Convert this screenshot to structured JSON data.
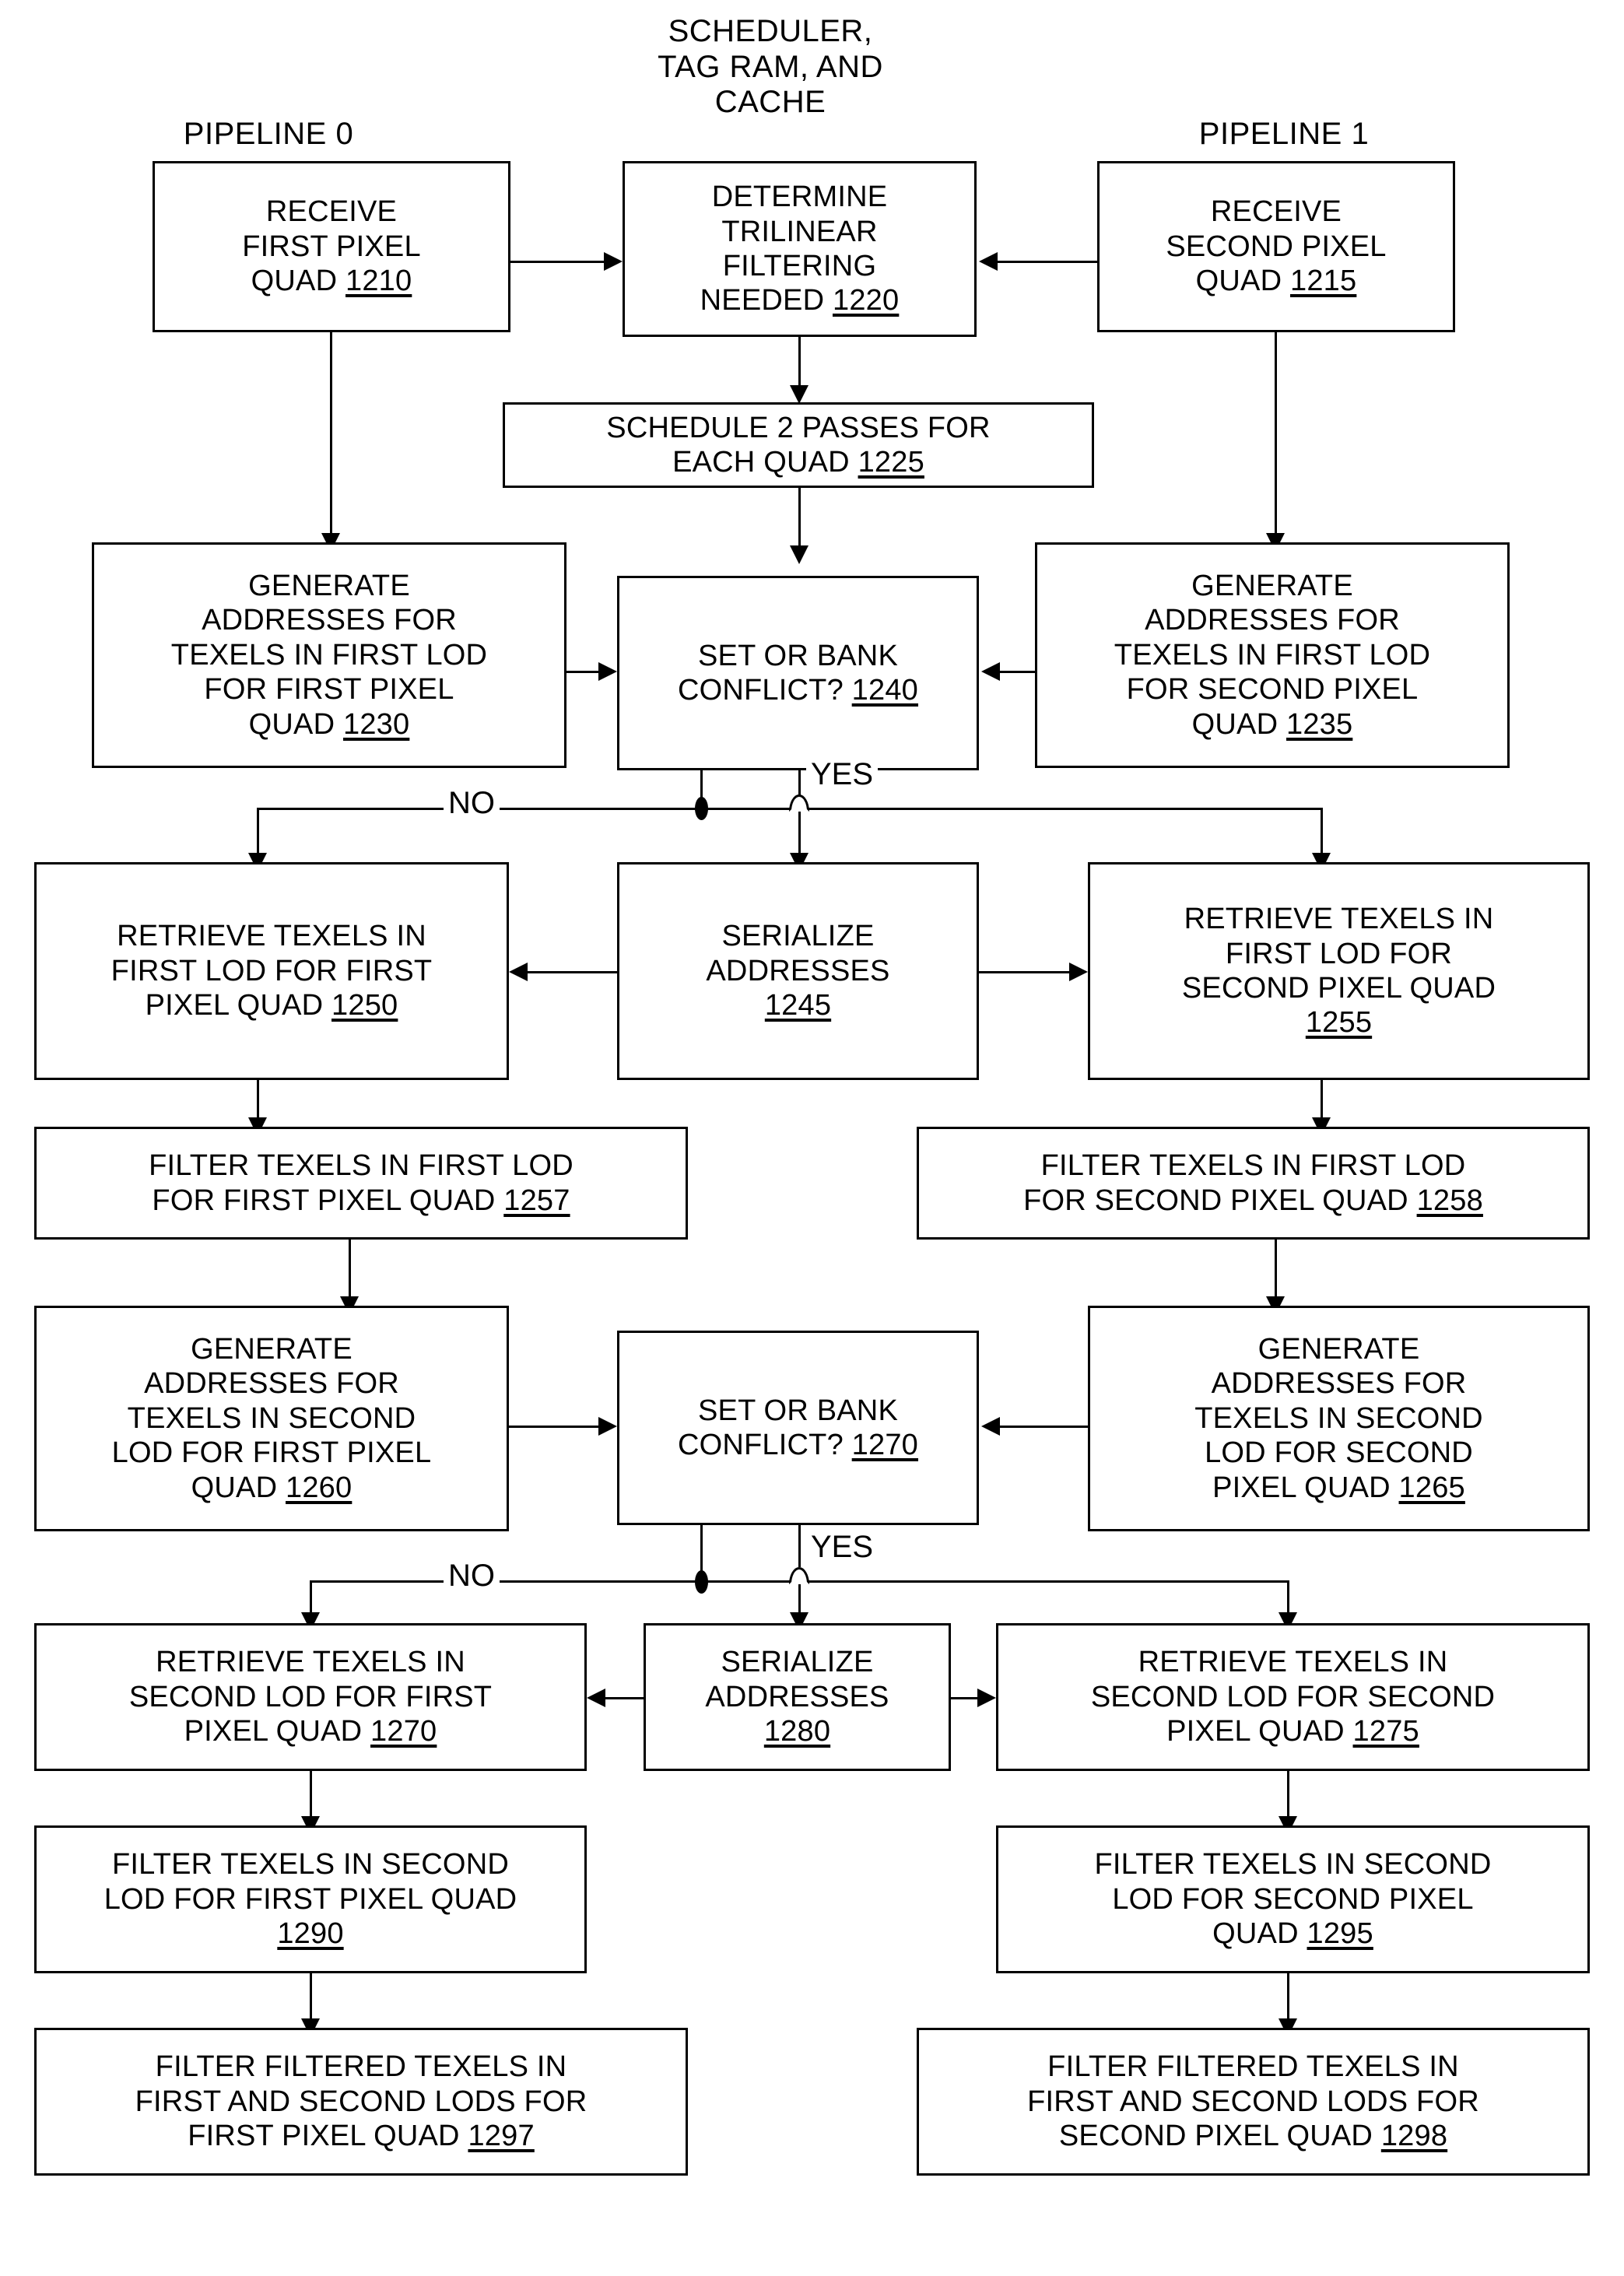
{
  "figure": {
    "type": "flowchart",
    "captions": [
      {
        "id": "pipeline0",
        "text": "PIPELINE 0"
      },
      {
        "id": "scheduler",
        "text": "SCHEDULER,\nTAG RAM, AND\nCACHE"
      },
      {
        "id": "pipeline1",
        "text": "PIPELINE 1"
      }
    ],
    "edge_labels": [
      {
        "id": "no1",
        "text": "NO"
      },
      {
        "id": "yes1",
        "text": "YES"
      },
      {
        "id": "no2",
        "text": "NO"
      },
      {
        "id": "yes2",
        "text": "YES"
      }
    ],
    "nodes": [
      {
        "id": "n1210",
        "lines": [
          "RECEIVE",
          "FIRST PIXEL",
          "QUAD "
        ],
        "ref": "1210"
      },
      {
        "id": "n1220",
        "lines": [
          "DETERMINE",
          "TRILINEAR",
          "FILTERING",
          "NEEDED  "
        ],
        "ref": "1220"
      },
      {
        "id": "n1215",
        "lines": [
          "RECEIVE",
          "SECOND PIXEL",
          "QUAD "
        ],
        "ref": "1215"
      },
      {
        "id": "n1225",
        "lines": [
          "SCHEDULE 2 PASSES FOR",
          "EACH QUAD  "
        ],
        "ref": "1225"
      },
      {
        "id": "n1230",
        "lines": [
          "GENERATE",
          "ADDRESSES  FOR",
          "TEXELS IN FIRST LOD",
          "FOR FIRST PIXEL",
          "QUAD "
        ],
        "ref": "1230"
      },
      {
        "id": "n1240",
        "lines": [
          "SET OR BANK",
          "CONFLICT?  "
        ],
        "ref": "1240"
      },
      {
        "id": "n1235",
        "lines": [
          "GENERATE",
          "ADDRESSES FOR",
          "TEXELS IN FIRST LOD",
          "FOR SECOND PIXEL",
          "QUAD  "
        ],
        "ref": "1235"
      },
      {
        "id": "n1250",
        "lines": [
          "RETRIEVE TEXELS IN",
          "FIRST LOD FOR FIRST",
          "PIXEL QUAD  "
        ],
        "ref": "1250"
      },
      {
        "id": "n1245",
        "lines": [
          "SERIALIZE",
          "ADDRESSES",
          ""
        ],
        "ref": "1245"
      },
      {
        "id": "n1255",
        "lines": [
          "RETRIEVE TEXELS IN",
          "FIRST LOD FOR",
          "SECOND PIXEL QUAD",
          ""
        ],
        "ref": "1255"
      },
      {
        "id": "n1257",
        "lines": [
          "FILTER TEXELS IN FIRST LOD",
          "FOR FIRST PIXEL QUAD  "
        ],
        "ref": "1257"
      },
      {
        "id": "n1258",
        "lines": [
          "FILTER TEXELS IN FIRST LOD",
          "FOR SECOND PIXEL QUAD  "
        ],
        "ref": "1258"
      },
      {
        "id": "n1260",
        "lines": [
          "GENERATE",
          "ADDRESSES FOR",
          "TEXELS IN SECOND",
          "LOD FOR FIRST PIXEL",
          "QUAD  "
        ],
        "ref": "1260"
      },
      {
        "id": "n1270d",
        "lines": [
          "SET OR BANK",
          "CONFLICT?  "
        ],
        "ref": "1270"
      },
      {
        "id": "n1265",
        "lines": [
          "GENERATE",
          "ADDRESSES FOR",
          "TEXELS IN SECOND",
          "LOD FOR SECOND",
          "PIXEL QUAD  "
        ],
        "ref": "1265"
      },
      {
        "id": "n1270r",
        "lines": [
          "RETRIEVE TEXELS IN",
          "SECOND LOD FOR FIRST",
          "PIXEL QUAD  "
        ],
        "ref": "1270"
      },
      {
        "id": "n1280",
        "lines": [
          "SERIALIZE",
          "ADDRESSES",
          ""
        ],
        "ref": "1280"
      },
      {
        "id": "n1275",
        "lines": [
          "RETRIEVE TEXELS IN",
          "SECOND LOD FOR SECOND",
          "PIXEL QUAD  "
        ],
        "ref": "1275"
      },
      {
        "id": "n1290",
        "lines": [
          "FILTER TEXELS IN SECOND",
          "LOD FOR FIRST PIXEL QUAD",
          ""
        ],
        "ref": "1290"
      },
      {
        "id": "n1295",
        "lines": [
          "FILTER TEXELS IN SECOND",
          "LOD FOR SECOND PIXEL",
          "QUAD  "
        ],
        "ref": "1295"
      },
      {
        "id": "n1297",
        "lines": [
          "FILTER FILTERED TEXELS IN",
          "FIRST AND SECOND LODS FOR",
          "FIRST PIXEL QUAD  "
        ],
        "ref": "1297"
      },
      {
        "id": "n1298",
        "lines": [
          "FILTER FILTERED TEXELS IN",
          "FIRST AND  SECOND LODS FOR",
          "SECOND PIXEL QUAD  "
        ],
        "ref": "1298"
      }
    ],
    "colors": {
      "stroke": "#000000",
      "fill": "#ffffff",
      "text": "#000000"
    }
  }
}
